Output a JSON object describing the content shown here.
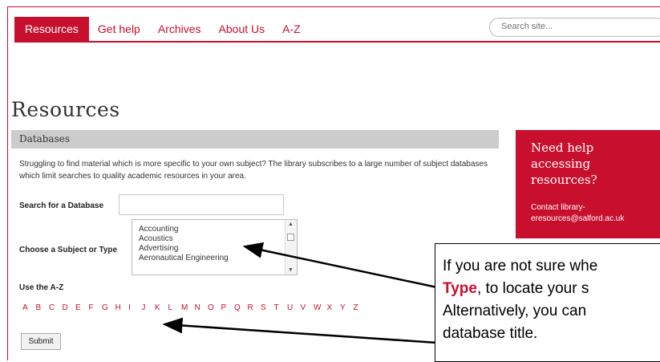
{
  "nav": {
    "items": [
      {
        "label": "Resources",
        "active": true
      },
      {
        "label": "Get help"
      },
      {
        "label": "Archives"
      },
      {
        "label": "About Us"
      },
      {
        "label": "A-Z"
      }
    ],
    "search_placeholder": "Search site..."
  },
  "page": {
    "title": "Resources"
  },
  "databases": {
    "header": "Databases",
    "intro": "Struggling to find material which is more specific to your own subject? The library subscribes to a large number of subject databases which limit searches to quality academic resources in your area.",
    "search_label": "Search for a Database",
    "subject_label": "Choose a Subject or Type",
    "subjects": [
      "Accounting",
      "Acoustics",
      "Advertising",
      "Aeronautical Engineering"
    ],
    "az_label": "Use the A-Z",
    "letters": [
      "A",
      "B",
      "C",
      "D",
      "E",
      "F",
      "G",
      "H",
      "I",
      "J",
      "K",
      "L",
      "M",
      "N",
      "O",
      "P",
      "Q",
      "R",
      "S",
      "T",
      "U",
      "V",
      "W",
      "X",
      "Y",
      "Z"
    ],
    "submit_label": "Submit"
  },
  "help_box": {
    "title": "Need help accessing resources?",
    "contact": "Contact library-eresources@salford.ac.uk"
  },
  "callout": {
    "line1": "If you are not sure whe",
    "line2_highlight": "Type",
    "line2_rest": ", to locate your s",
    "line3": "Alternatively, you can",
    "line4": "database title."
  },
  "colors": {
    "brand": "#c8102e",
    "panel_header": "#cccccc",
    "annotation": "#000000"
  },
  "icons": {
    "scroll_up": "scroll-up-icon",
    "scroll_down": "scroll-down-icon"
  }
}
